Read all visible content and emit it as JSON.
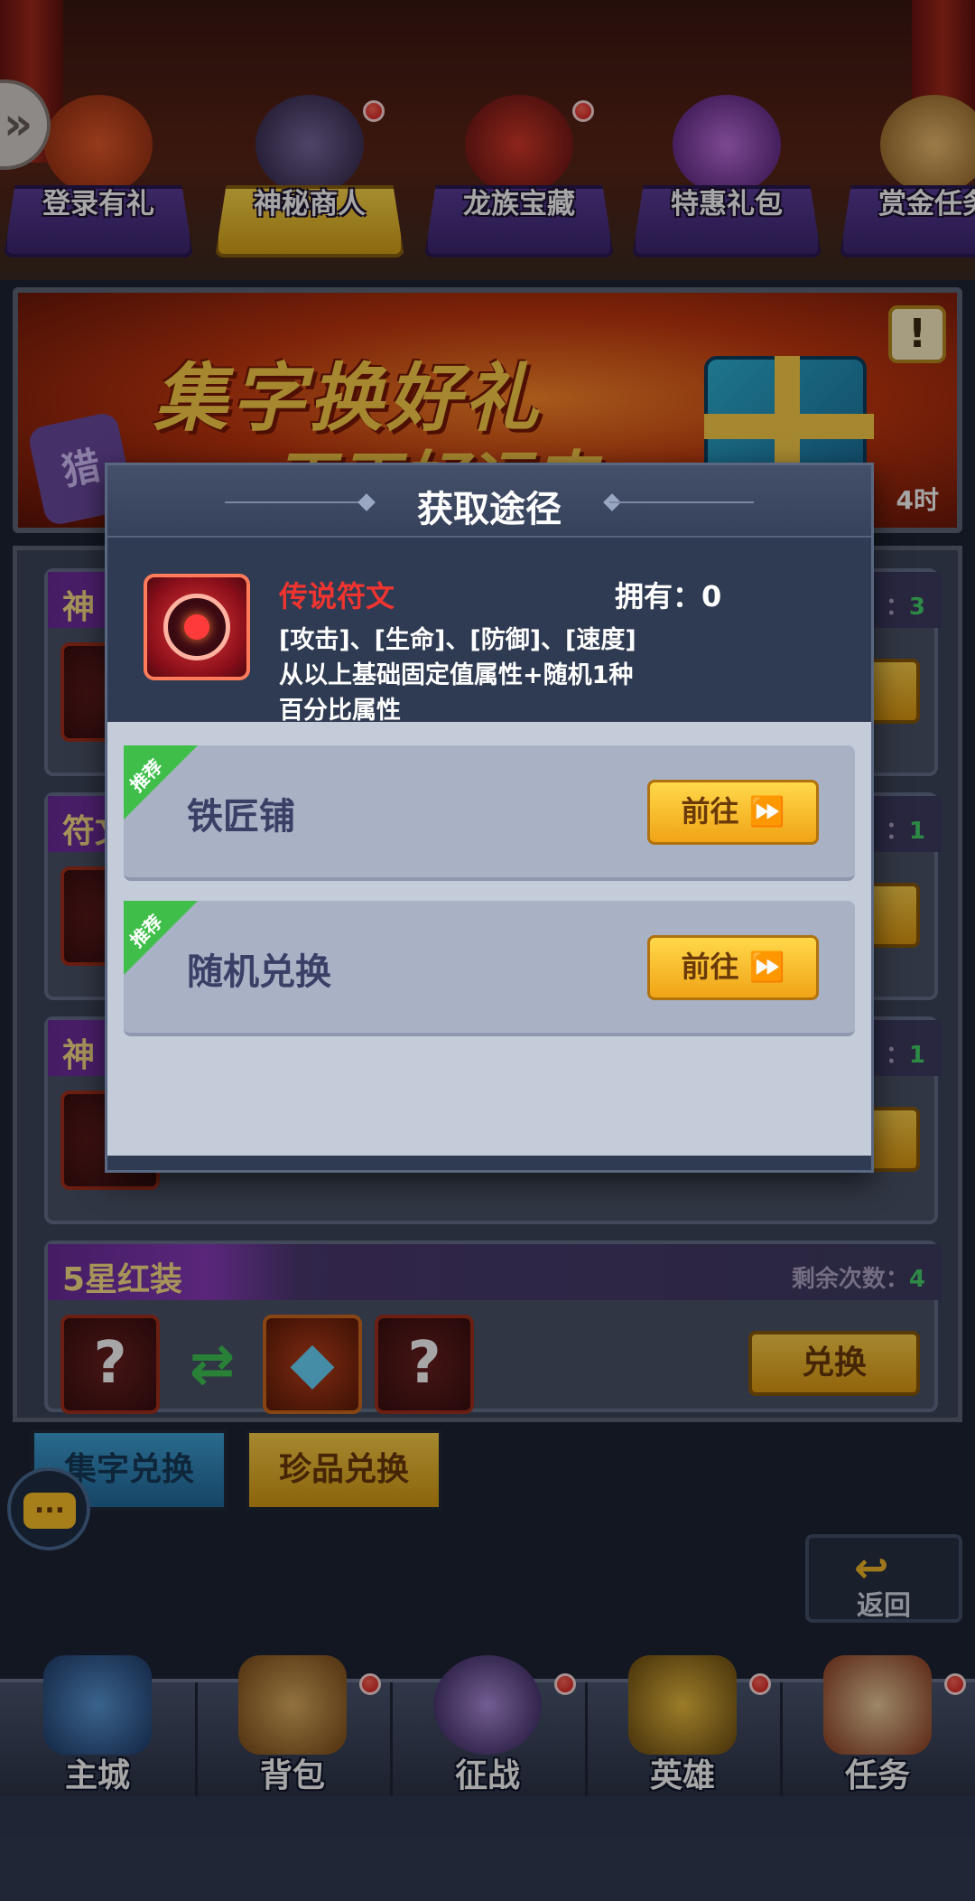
{
  "event_tabs": [
    {
      "label": "登录有礼",
      "icon": "gift-box-icon",
      "active": false,
      "dot": false
    },
    {
      "label": "神秘商人",
      "icon": "hooded-merchant-icon",
      "active": true,
      "dot": true
    },
    {
      "label": "龙族宝藏",
      "icon": "dragon-treasure-icon",
      "active": false,
      "dot": true
    },
    {
      "label": "特惠礼包",
      "icon": "money-bag-icon",
      "active": false,
      "dot": false
    },
    {
      "label": "赏金任务",
      "icon": "scroll-icon",
      "active": false,
      "dot": false
    }
  ],
  "banner": {
    "title": "集字换好礼",
    "subtitle": "天天好运来",
    "char": "猎",
    "info": "!",
    "time_suffix": "4时"
  },
  "exchange_rows": [
    {
      "title": "神",
      "remaining_label": "：",
      "remaining": "3"
    },
    {
      "title": "符文",
      "remaining_label": "：",
      "remaining": "1"
    },
    {
      "title": "神",
      "remaining_label": "：",
      "remaining": "1"
    },
    {
      "title": "5星红装",
      "remaining_label": "剩余次数：",
      "remaining": "4",
      "button": "兑换"
    }
  ],
  "sub_tabs": {
    "word_exchange": "集字兑换",
    "treasure_exchange": "珍品兑换"
  },
  "chat_icon": "...",
  "back_button": {
    "label": "返回",
    "icon": "back-arrow-icon"
  },
  "bottom_nav": [
    {
      "label": "主城",
      "icon": "castle-icon",
      "dot": false
    },
    {
      "label": "背包",
      "icon": "treasure-chest-icon",
      "dot": true
    },
    {
      "label": "征战",
      "icon": "dragon-battle-icon",
      "dot": true
    },
    {
      "label": "英雄",
      "icon": "hero-helmet-icon",
      "dot": true
    },
    {
      "label": "任务",
      "icon": "quest-scroll-icon",
      "dot": true
    }
  ],
  "dialog": {
    "title": "获取途径",
    "item": {
      "name": "传说符文",
      "owned": "拥有：0",
      "desc_line1": "[攻击]、[生命]、[防御]、[速度]",
      "desc_line2": "从以上基础固定值属性+随机1种",
      "desc_line3": "百分比属性",
      "icon": "legendary-rune-icon"
    },
    "ways": [
      {
        "tag": "推荐",
        "name": "铁匠铺",
        "button": "前往 ⏩"
      },
      {
        "tag": "推荐",
        "name": "随机兑换",
        "button": "前往 ⏩"
      }
    ]
  },
  "colors": {
    "item_name": "#f0342f",
    "recommend_tag": "#3fbf4a",
    "go_button": "#ffd84a",
    "dialog_bg": "#2f3b52"
  }
}
